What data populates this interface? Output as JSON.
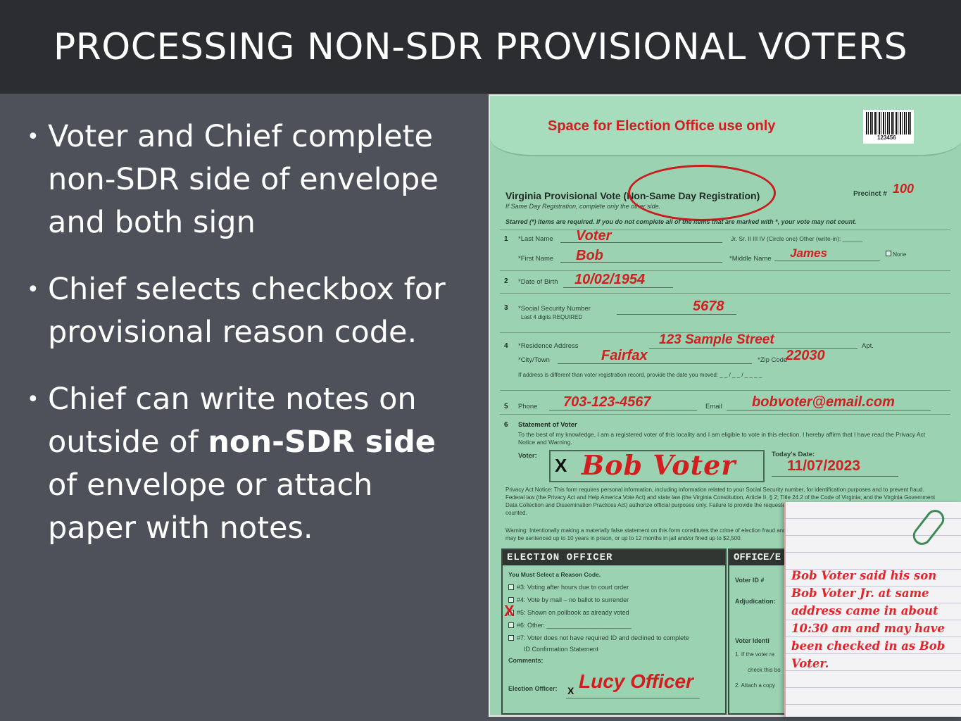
{
  "title": "PROCESSING NON-SDR PROVISIONAL VOTERS",
  "bullets": [
    {
      "text": "Voter and Chief complete non-SDR side of envelope and both sign"
    },
    {
      "text": "Chief selects checkbox for provisional reason code."
    },
    {
      "before": "Chief can write notes on outside of ",
      "bold": "non-SDR side",
      "after": " of envelope or attach paper with notes."
    }
  ],
  "envelope": {
    "office_use": "Space for Election Office use only",
    "barcode_number": "123456",
    "form_title": "Virginia Provisional Vote (Non-Same Day Registration)",
    "form_subtitle": "If Same Day Registration, complete only the other side.",
    "precinct_label": "Precinct #",
    "precinct_value": "100",
    "starred_note": "Starred (*) items are required. If you do not complete all of the items that are marked with *, your vote may not count.",
    "fields": {
      "last_name_label": "*Last Name",
      "last_name": "Voter",
      "suffix_label": "Jr. Sr. II III IV (Circle one) Other (write-in): ______",
      "first_name_label": "*First Name",
      "first_name": "Bob",
      "middle_name_label": "*Middle Name",
      "middle_name": "James",
      "none_label": "None",
      "dob_label": "*Date of Birth",
      "dob": "10/02/1954",
      "ssn_label": "*Social Security Number",
      "ssn_sub": "Last 4 digits REQUIRED",
      "ssn": "5678",
      "address_label": "*Residence Address",
      "address": "123 Sample Street",
      "apt_label": "Apt.",
      "city_label": "*City/Town",
      "city": "Fairfax",
      "zip_label": "*Zip Code",
      "zip": "22030",
      "moved_text": "If address is different than voter registration record, provide the date you moved: _ _ / _ _ / _ _ _ _",
      "phone_label": "Phone",
      "phone": "703-123-4567",
      "email_label": "Email",
      "email": "bobvoter@email.com"
    },
    "statement_title": "Statement of Voter",
    "statement_text": "To the best of my knowledge, I am a registered voter of this locality and I am eligible to vote in this election. I hereby affirm that I have read the Privacy Act Notice and Warning.",
    "voter_label": "Voter:",
    "voter_signature": "Bob Voter",
    "sign_x": "X",
    "today_label": "Today's Date:",
    "today": "11/07/2023",
    "privacy_text": "Privacy Act Notice: This form requires personal information, including information related to your Social Security number, for identification purposes and to prevent fraud. Federal law (the Privacy Act and Help America Vote Act) and state law (the Virginia Constitution, Article II, § 2; Title 24.2 of the Code of Virginia; and the Virginia Government Data Collection and Dissemination Practices Act) authorize official purposes only. Failure to provide the requested information may prevent determining your not being counted.",
    "warning_text": "Warning: Intentionally making a materially false statement on this form constitutes the crime of election fraud and may be sentenced up to 10 years in prison, or up to 12 months in jail and/or fined up to $2,500.",
    "election_officer": {
      "header": "ELECTION OFFICER",
      "instruction": "You Must Select a Reason Code.",
      "reasons": [
        "#3: Voting after hours due to court order",
        "#4: Vote by mail – no ballot to surrender",
        "#5: Shown on pollbook as already voted",
        "#6: Other: ________________________",
        "#7: Voter does not have required ID and declined to complete"
      ],
      "reason7_cont": "ID Confirmation Statement",
      "selected_mark": "X",
      "comments_label": "Comments:",
      "officer_label": "Election Officer:",
      "officer_x": "X",
      "officer_signature": "Lucy Officer"
    },
    "office_box": {
      "header": "OFFICE/E",
      "voter_id": "Voter ID #",
      "adjudication": "Adjudication:",
      "voter_identification": "Voter Identi",
      "item1": "1. If the voter re",
      "item1b": "check this bo",
      "item2": "2. Attach a copy"
    }
  },
  "note": {
    "text": "Bob Voter said his son Bob Voter Jr. at same address came in about 10:30 am and may have been checked in as Bob Voter."
  }
}
